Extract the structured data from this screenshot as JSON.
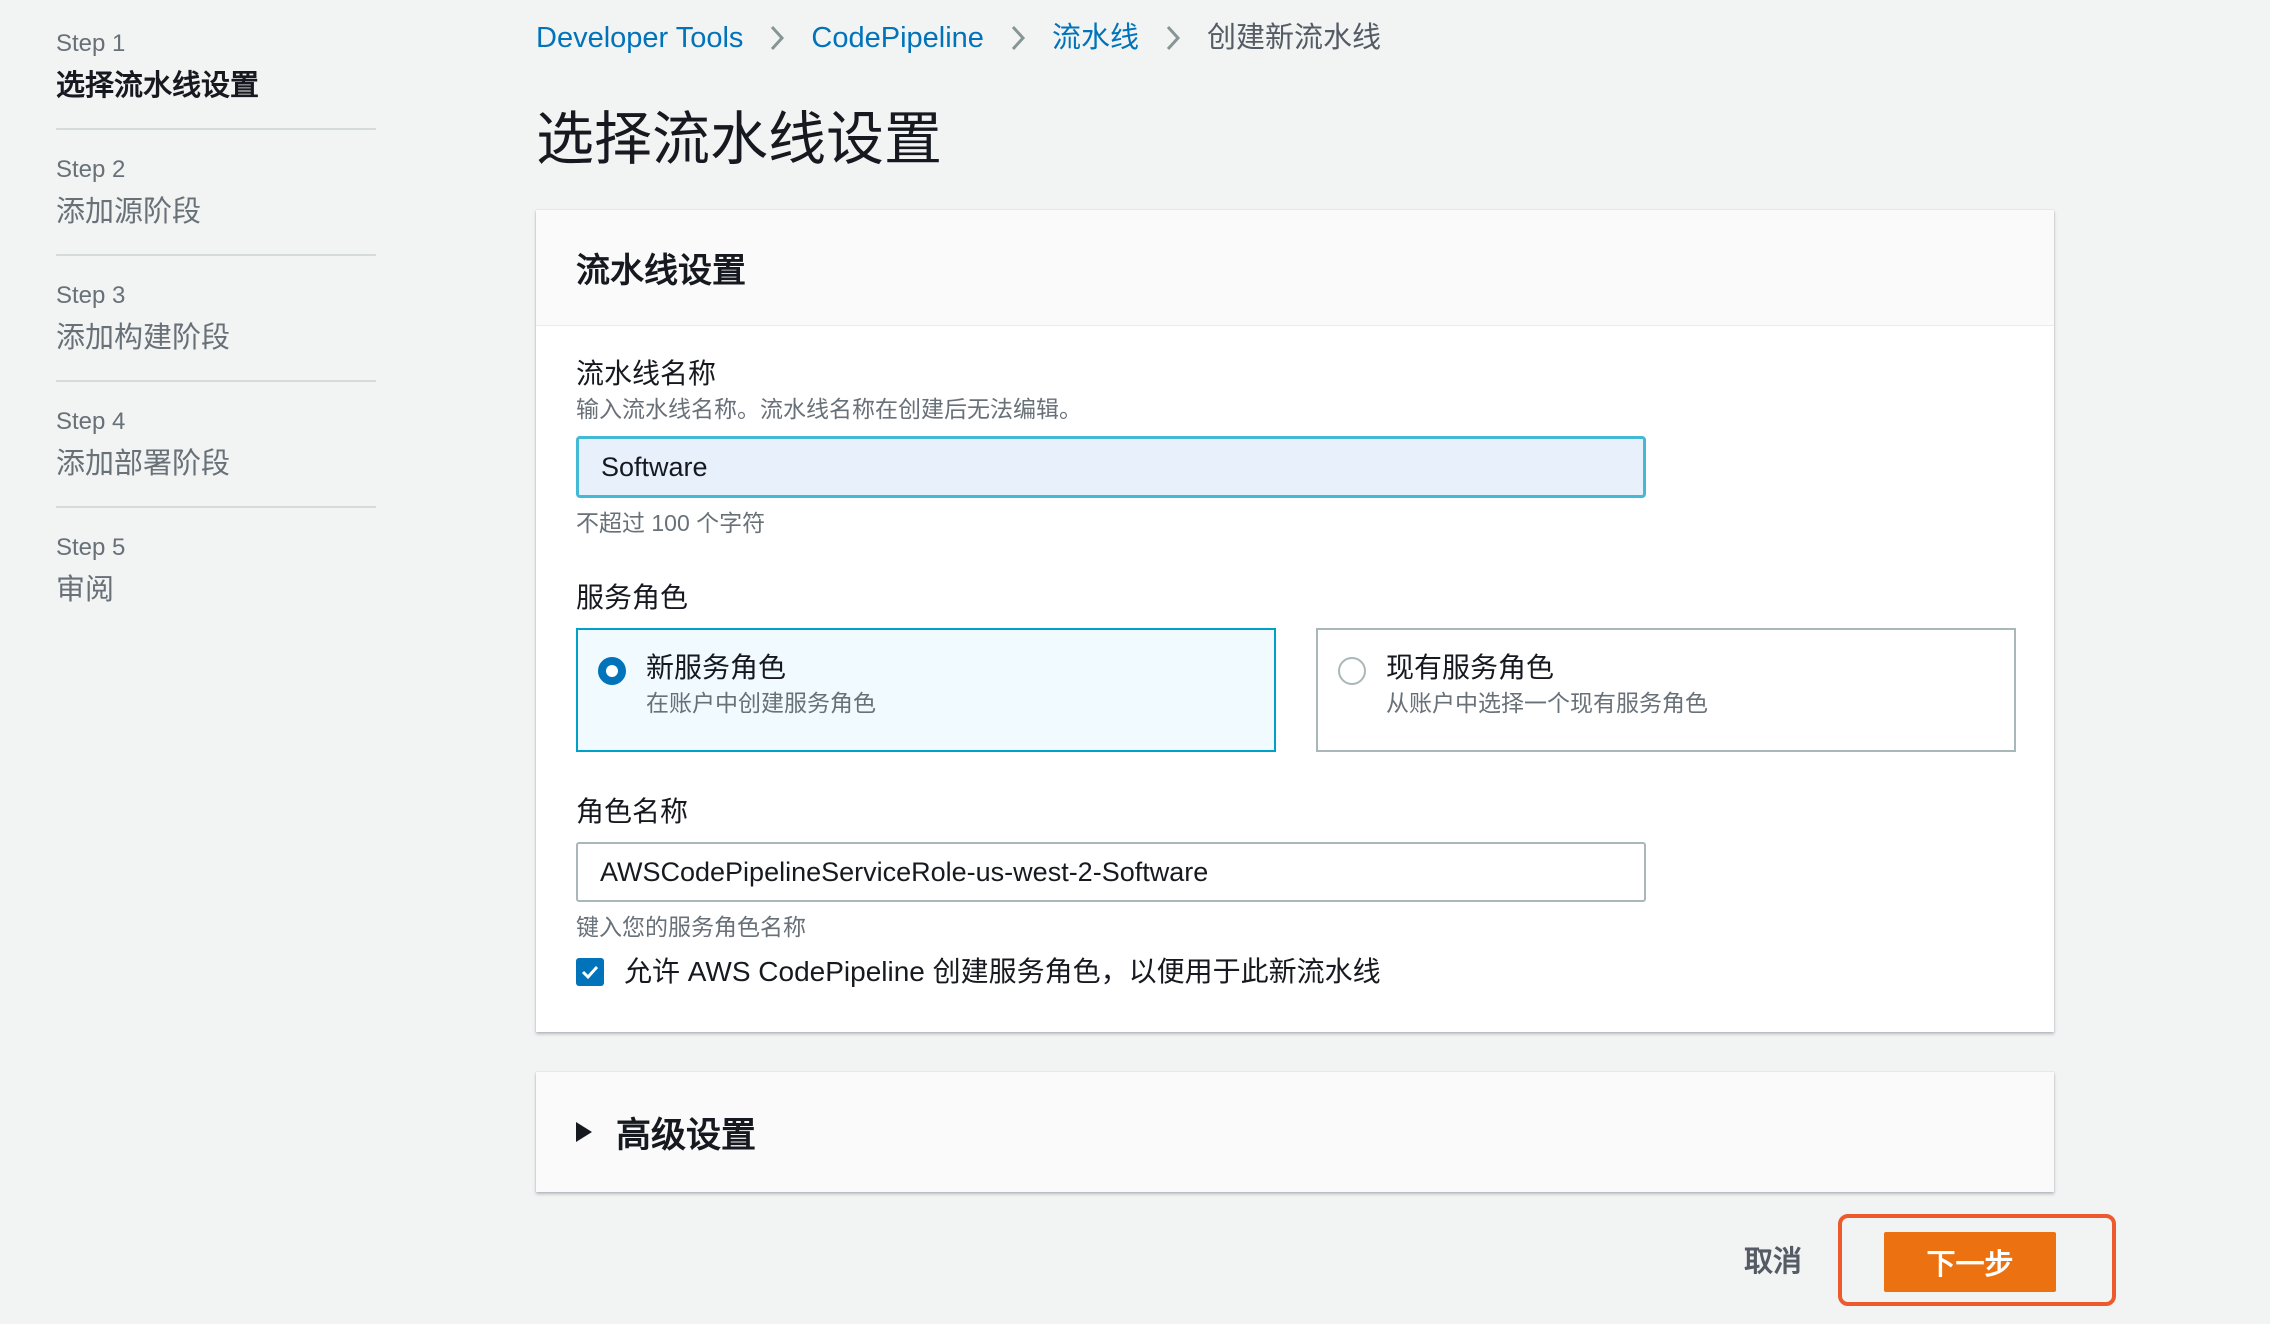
{
  "steps": [
    {
      "num": "Step 1",
      "title": "选择流水线设置",
      "active": true
    },
    {
      "num": "Step 2",
      "title": "添加源阶段"
    },
    {
      "num": "Step 3",
      "title": "添加构建阶段"
    },
    {
      "num": "Step 4",
      "title": "添加部署阶段"
    },
    {
      "num": "Step 5",
      "title": "审阅"
    }
  ],
  "breadcrumb": [
    "Developer Tools",
    "CodePipeline",
    "流水线",
    "创建新流水线"
  ],
  "page": {
    "title": "选择流水线设置"
  },
  "settings": {
    "header": "流水线设置",
    "pipeline_name": {
      "label": "流水线名称",
      "description": "输入流水线名称。流水线名称在创建后无法编辑。",
      "value": "Software",
      "constraint": "不超过 100 个字符"
    },
    "service_role": {
      "label": "服务角色",
      "options": [
        {
          "title": "新服务角色",
          "description": "在账户中创建服务角色",
          "selected": true
        },
        {
          "title": "现有服务角色",
          "description": "从账户中选择一个现有服务角色",
          "selected": false
        }
      ]
    },
    "role_name": {
      "label": "角色名称",
      "value": "AWSCodePipelineServiceRole-us-west-2-Software",
      "description": "键入您的服务角色名称"
    },
    "allow_checkbox": {
      "label": "允许 AWS CodePipeline 创建服务角色，以便用于此新流水线",
      "checked": true
    }
  },
  "advanced": {
    "title": "高级设置"
  },
  "actions": {
    "cancel": "取消",
    "next": "下一步"
  },
  "colors": {
    "primary_button": "#ec7211",
    "link": "#0073bb",
    "highlight_border": "#ec5a2e",
    "input_focus_border": "#44b9d6"
  }
}
